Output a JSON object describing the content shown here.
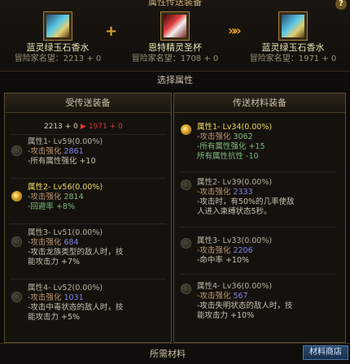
{
  "header": {
    "title": "属性传送装备"
  },
  "help_icon": "?",
  "items": [
    {
      "name": "蓝灵绿玉石香水",
      "fame": "冒险家名望：2213 + 0",
      "icon": "perfume-bottle-icon"
    },
    {
      "name": "恩特精灵圣杯",
      "fame": "冒险家名望：1708 + 0",
      "icon": "chalice-icon"
    },
    {
      "name": "蓝灵绿玉石香水",
      "fame": "冒险家名望：1971 + 0",
      "icon": "perfume-bottle-icon"
    }
  ],
  "plus_symbol": "+",
  "arrow_symbol": "»»",
  "select_title": "选择属性",
  "left": {
    "title": "受传送装备",
    "fame_from": "2213 + 0",
    "fame_to": "1971 + 0",
    "options": [
      {
        "header": "属性1- Lv59(0.00%)",
        "sub_label": "-攻击强化",
        "sub_value": "2861",
        "desc": [
          "-所有属性强化 +10"
        ]
      },
      {
        "header": "属性2- Lv56(0.00%)",
        "sub_label": "-攻击强化",
        "sub_value": "2814",
        "desc": [
          "-回避率 +8%"
        ]
      },
      {
        "header": "属性3- Lv51(0.00%)",
        "sub_label": "-攻击强化",
        "sub_value": "684",
        "desc": [
          "-攻击龙族类型的敌人时，技",
          " 能攻击力 +7%"
        ]
      },
      {
        "header": "属性4- Lv52(0.00%)",
        "sub_label": "-攻击强化",
        "sub_value": "1031",
        "desc": [
          "-攻击中毒状态的敌人时，技",
          " 能攻击力 +5%"
        ]
      }
    ]
  },
  "right": {
    "title": "传送材料装备",
    "options": [
      {
        "header": "属性1- Lv34(0.00%)",
        "sub_label": "-攻击强化",
        "sub_value": "3062",
        "desc": [
          "-所有属性强化 +15",
          " 所有属性抗性 -10"
        ]
      },
      {
        "header": "属性2- Lv39(0.00%)",
        "sub_label": "-攻击强化",
        "sub_value": "2333",
        "desc": [
          "-攻击时，有50%的几率使敌",
          " 人进入束缚状态5秒。"
        ]
      },
      {
        "header": "属性3- Lv33(0.00%)",
        "sub_label": "-攻击强化",
        "sub_value": "2206",
        "desc": [
          "-命中率 +10%"
        ]
      },
      {
        "header": "属性4- Lv36(0.00%)",
        "sub_label": "-攻击强化",
        "sub_value": "567",
        "desc": [
          "-攻击失明状态的敌人时，技",
          " 能攻击力 +10%"
        ]
      }
    ]
  },
  "bottom": {
    "required_label": "所需材料",
    "shop_label": "材料商店"
  },
  "colors": {
    "selected": "#e8d860",
    "accent": "#e0a030"
  }
}
